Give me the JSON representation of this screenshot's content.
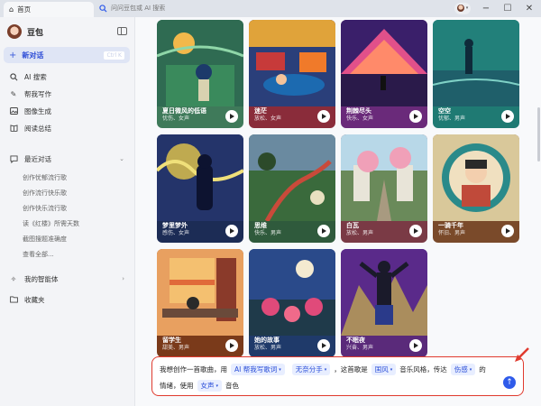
{
  "titlebar": {
    "home_tab": "首页",
    "search_placeholder": "问问豆包或 AI 搜索"
  },
  "sidebar": {
    "brand": "豆包",
    "new_chat": "新对话",
    "new_chat_shortcut": "Ctrl K",
    "items": [
      {
        "label": "AI 搜索",
        "icon": "search-icon"
      },
      {
        "label": "帮我写作",
        "icon": "pen-icon"
      },
      {
        "label": "图像生成",
        "icon": "image-icon"
      },
      {
        "label": "阅读总结",
        "icon": "book-icon"
      }
    ],
    "recent_label": "最近对话",
    "recent": [
      "创作忧郁流行歌",
      "创作流行快乐歌",
      "创作快乐流行歌",
      "读《红楼》所需天数",
      "截图搜题准确度",
      "查看全部..."
    ],
    "agents": "我的智能体",
    "favorites": "收藏夹"
  },
  "cards": [
    {
      "title": "夏日微风的低语",
      "tags": "忧伤、女声",
      "bg": "#3f7a5a",
      "icon": "song-cover-summer-breeze"
    },
    {
      "title": "迷茫",
      "tags": "放松、女声",
      "bg": "#8a2c3a",
      "icon": "song-cover-lost"
    },
    {
      "title": "荆棘尽头",
      "tags": "快乐、女声",
      "bg": "#6a2a7a",
      "icon": "song-cover-thorns-end"
    },
    {
      "title": "空空",
      "tags": "忧郁、男声",
      "bg": "#1f7a73",
      "icon": "song-cover-empty"
    },
    {
      "title": "梦里梦外",
      "tags": "感伤、女声",
      "bg": "#1c2c55",
      "icon": "song-cover-dream"
    },
    {
      "title": "思维",
      "tags": "快乐、男声",
      "bg": "#2f5a3c",
      "icon": "song-cover-thinking"
    },
    {
      "title": "白瓦",
      "tags": "放松、男声",
      "bg": "#7a3a45",
      "icon": "song-cover-white-tile"
    },
    {
      "title": "一骑千年",
      "tags": "怀旧、男声",
      "bg": "#7a4a2a",
      "icon": "song-cover-thousand-years"
    },
    {
      "title": "留学生",
      "tags": "甜美、男声",
      "bg": "#7a3a1a",
      "icon": "song-cover-student"
    },
    {
      "title": "她的故事",
      "tags": "放松、男声",
      "bg": "#1f3a6a",
      "icon": "song-cover-her-story"
    },
    {
      "title": "不眠夜",
      "tags": "兴奋、男声",
      "bg": "#5a2a7a",
      "icon": "song-cover-sleepless-night"
    }
  ],
  "prompt": {
    "line1_a": "我想创作一首歌曲，用",
    "chip_tool": "AI 帮我写歌词",
    "chip_topic": "无奈分手",
    "line1_b": "，这首歌是",
    "chip_style": "国风",
    "line1_c": "音乐风格，传达",
    "chip_mood": "伤感",
    "line1_d": "的",
    "line2_a": "情绪，使用",
    "chip_voice": "女声",
    "line2_b": "音色"
  }
}
